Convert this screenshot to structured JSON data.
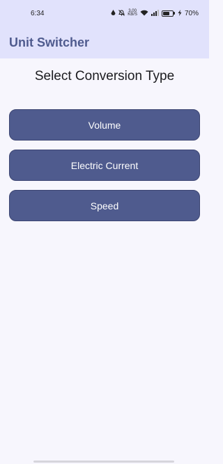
{
  "status_bar": {
    "time": "6:34",
    "net_speed_value": "3.00",
    "net_speed_unit": "KB/S",
    "battery_percent": "70%",
    "battery_level": 0.7,
    "icons": [
      "drop-icon",
      "mute-bell-icon",
      "wifi-icon",
      "signal-icon",
      "battery-icon",
      "charging-bolt-icon"
    ]
  },
  "app_bar": {
    "title": "Unit Switcher"
  },
  "main": {
    "heading": "Select Conversion Type",
    "options": [
      "Volume",
      "Electric Current",
      "Speed"
    ]
  },
  "colors": {
    "app_bar_bg": "#e1e2fc",
    "title_color": "#4f5b8e",
    "button_bg": "#4f5b8e",
    "page_bg": "#f7f6fd"
  }
}
